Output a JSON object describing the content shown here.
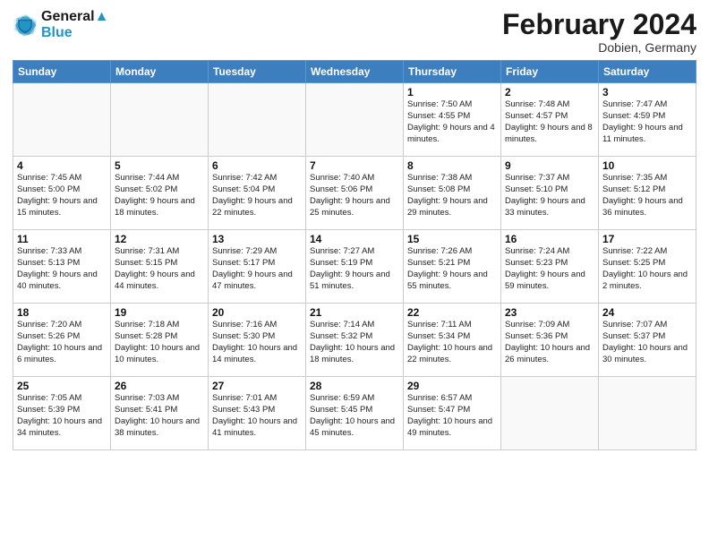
{
  "header": {
    "logo_line1": "General",
    "logo_line2": "Blue",
    "month_year": "February 2024",
    "location": "Dobien, Germany"
  },
  "days_of_week": [
    "Sunday",
    "Monday",
    "Tuesday",
    "Wednesday",
    "Thursday",
    "Friday",
    "Saturday"
  ],
  "weeks": [
    [
      {
        "num": "",
        "info": ""
      },
      {
        "num": "",
        "info": ""
      },
      {
        "num": "",
        "info": ""
      },
      {
        "num": "",
        "info": ""
      },
      {
        "num": "1",
        "info": "Sunrise: 7:50 AM\nSunset: 4:55 PM\nDaylight: 9 hours\nand 4 minutes."
      },
      {
        "num": "2",
        "info": "Sunrise: 7:48 AM\nSunset: 4:57 PM\nDaylight: 9 hours\nand 8 minutes."
      },
      {
        "num": "3",
        "info": "Sunrise: 7:47 AM\nSunset: 4:59 PM\nDaylight: 9 hours\nand 11 minutes."
      }
    ],
    [
      {
        "num": "4",
        "info": "Sunrise: 7:45 AM\nSunset: 5:00 PM\nDaylight: 9 hours\nand 15 minutes."
      },
      {
        "num": "5",
        "info": "Sunrise: 7:44 AM\nSunset: 5:02 PM\nDaylight: 9 hours\nand 18 minutes."
      },
      {
        "num": "6",
        "info": "Sunrise: 7:42 AM\nSunset: 5:04 PM\nDaylight: 9 hours\nand 22 minutes."
      },
      {
        "num": "7",
        "info": "Sunrise: 7:40 AM\nSunset: 5:06 PM\nDaylight: 9 hours\nand 25 minutes."
      },
      {
        "num": "8",
        "info": "Sunrise: 7:38 AM\nSunset: 5:08 PM\nDaylight: 9 hours\nand 29 minutes."
      },
      {
        "num": "9",
        "info": "Sunrise: 7:37 AM\nSunset: 5:10 PM\nDaylight: 9 hours\nand 33 minutes."
      },
      {
        "num": "10",
        "info": "Sunrise: 7:35 AM\nSunset: 5:12 PM\nDaylight: 9 hours\nand 36 minutes."
      }
    ],
    [
      {
        "num": "11",
        "info": "Sunrise: 7:33 AM\nSunset: 5:13 PM\nDaylight: 9 hours\nand 40 minutes."
      },
      {
        "num": "12",
        "info": "Sunrise: 7:31 AM\nSunset: 5:15 PM\nDaylight: 9 hours\nand 44 minutes."
      },
      {
        "num": "13",
        "info": "Sunrise: 7:29 AM\nSunset: 5:17 PM\nDaylight: 9 hours\nand 47 minutes."
      },
      {
        "num": "14",
        "info": "Sunrise: 7:27 AM\nSunset: 5:19 PM\nDaylight: 9 hours\nand 51 minutes."
      },
      {
        "num": "15",
        "info": "Sunrise: 7:26 AM\nSunset: 5:21 PM\nDaylight: 9 hours\nand 55 minutes."
      },
      {
        "num": "16",
        "info": "Sunrise: 7:24 AM\nSunset: 5:23 PM\nDaylight: 9 hours\nand 59 minutes."
      },
      {
        "num": "17",
        "info": "Sunrise: 7:22 AM\nSunset: 5:25 PM\nDaylight: 10 hours\nand 2 minutes."
      }
    ],
    [
      {
        "num": "18",
        "info": "Sunrise: 7:20 AM\nSunset: 5:26 PM\nDaylight: 10 hours\nand 6 minutes."
      },
      {
        "num": "19",
        "info": "Sunrise: 7:18 AM\nSunset: 5:28 PM\nDaylight: 10 hours\nand 10 minutes."
      },
      {
        "num": "20",
        "info": "Sunrise: 7:16 AM\nSunset: 5:30 PM\nDaylight: 10 hours\nand 14 minutes."
      },
      {
        "num": "21",
        "info": "Sunrise: 7:14 AM\nSunset: 5:32 PM\nDaylight: 10 hours\nand 18 minutes."
      },
      {
        "num": "22",
        "info": "Sunrise: 7:11 AM\nSunset: 5:34 PM\nDaylight: 10 hours\nand 22 minutes."
      },
      {
        "num": "23",
        "info": "Sunrise: 7:09 AM\nSunset: 5:36 PM\nDaylight: 10 hours\nand 26 minutes."
      },
      {
        "num": "24",
        "info": "Sunrise: 7:07 AM\nSunset: 5:37 PM\nDaylight: 10 hours\nand 30 minutes."
      }
    ],
    [
      {
        "num": "25",
        "info": "Sunrise: 7:05 AM\nSunset: 5:39 PM\nDaylight: 10 hours\nand 34 minutes."
      },
      {
        "num": "26",
        "info": "Sunrise: 7:03 AM\nSunset: 5:41 PM\nDaylight: 10 hours\nand 38 minutes."
      },
      {
        "num": "27",
        "info": "Sunrise: 7:01 AM\nSunset: 5:43 PM\nDaylight: 10 hours\nand 41 minutes."
      },
      {
        "num": "28",
        "info": "Sunrise: 6:59 AM\nSunset: 5:45 PM\nDaylight: 10 hours\nand 45 minutes."
      },
      {
        "num": "29",
        "info": "Sunrise: 6:57 AM\nSunset: 5:47 PM\nDaylight: 10 hours\nand 49 minutes."
      },
      {
        "num": "",
        "info": ""
      },
      {
        "num": "",
        "info": ""
      }
    ]
  ]
}
